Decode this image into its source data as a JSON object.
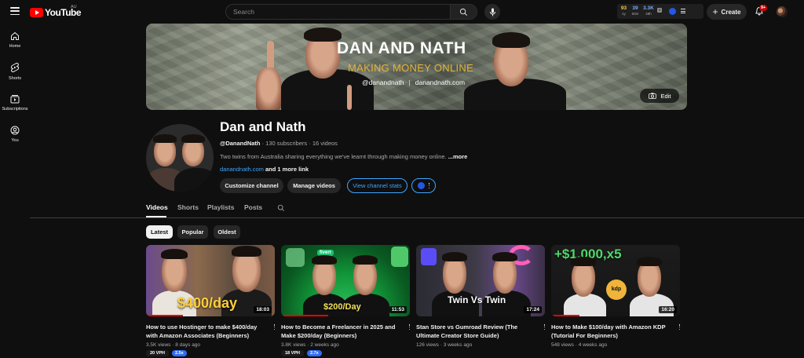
{
  "topbar": {
    "logo_text": "YouTube",
    "region": "AU",
    "search_placeholder": "Search",
    "stats": [
      {
        "value": "93",
        "label": "1y",
        "color": "#f2c94c"
      },
      {
        "value": "39",
        "label": "60m",
        "color": "#7aa7ff"
      },
      {
        "value": "3.3K",
        "label": "48h",
        "color": "#7aa7ff"
      }
    ],
    "create_label": "Create",
    "notification_count": "9+"
  },
  "leftnav": {
    "items": [
      {
        "label": "Home",
        "icon": "home-icon"
      },
      {
        "label": "Shorts",
        "icon": "shorts-icon"
      },
      {
        "label": "Subscriptions",
        "icon": "subscriptions-icon"
      },
      {
        "label": "You",
        "icon": "you-icon"
      }
    ]
  },
  "banner": {
    "title": "DAN AND NATH",
    "tagline": "MAKING MONEY ONLINE",
    "handle": "@danandnath",
    "site": "danandnath.com",
    "edit_label": "Edit"
  },
  "channel": {
    "name": "Dan and Nath",
    "handle": "@DanandNath",
    "subscribers": "130 subscribers",
    "videos_count": "16 videos",
    "sep": "·",
    "description": "Two twins from Australia sharing everything we've learnt through making money online.",
    "more": "...more",
    "link_url": "danandnath.com",
    "link_more": "and 1 more link",
    "buttons": {
      "customize": "Customize channel",
      "manage": "Manage videos",
      "stats": "View channel stats"
    }
  },
  "tabs": [
    "Videos",
    "Shorts",
    "Playlists",
    "Posts"
  ],
  "chips": [
    "Latest",
    "Popular",
    "Oldest"
  ],
  "videos": [
    {
      "title": "How to use Hostinger to make $400/day with Amazon Associates (Beginners)",
      "duration": "18:03",
      "thumb_text": "$400/day",
      "views": "3.5K views",
      "age": "8 days ago",
      "vph": "20 VPH",
      "multiplier": "2.5x"
    },
    {
      "title": "How to Become a Freelancer in 2025 and Make $200/day (Beginners)",
      "duration": "11:53",
      "thumb_text": "$200/Day",
      "thumb_badge": "fiverr",
      "views": "3.8K views",
      "age": "2 weeks ago",
      "vph": "18 VPH",
      "multiplier": "2.7x"
    },
    {
      "title": "Stan Store vs Gumroad Review (The Ultimate Creator Store Guide)",
      "duration": "17:24",
      "thumb_text": "Twin Vs Twin",
      "views": "126 views",
      "age": "3 weeks ago"
    },
    {
      "title": "How to Make $100/day with Amazon KDP (Tutorial For Beginners)",
      "duration": "16:20",
      "thumb_text": "+$1,000,x5",
      "thumb_badge": "kdp",
      "views": "548 views",
      "age": "4 weeks ago"
    }
  ]
}
